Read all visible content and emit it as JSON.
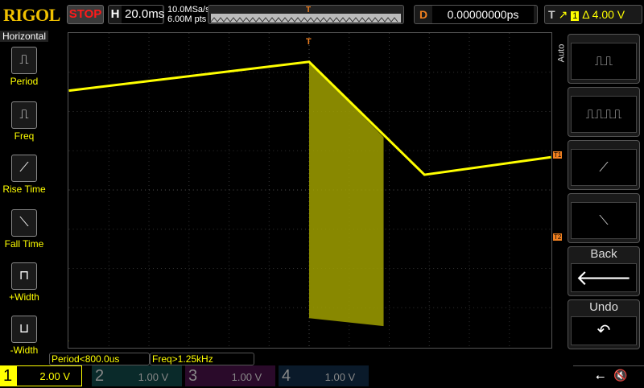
{
  "header": {
    "logo": "RIGOL",
    "run_state": "STOP",
    "horizontal_key": "H",
    "timebase": "20.0ms",
    "sample_rate": "10.0MSa/s",
    "memory_depth": "6.00M pts",
    "delay_key": "D",
    "delay": "0.00000000ps",
    "trigger_key": "T",
    "trigger_source": "1",
    "trigger_level": "Δ 4.00 V"
  },
  "left_menu": {
    "title": "Horizontal",
    "items": [
      {
        "label": "Period"
      },
      {
        "label": "Freq"
      },
      {
        "label": "Rise Time"
      },
      {
        "label": "Fall Time"
      },
      {
        "label": "+Width"
      },
      {
        "label": "-Width"
      }
    ]
  },
  "right_menu": {
    "mode": "Auto",
    "back": "Back",
    "undo": "Undo"
  },
  "markers": {
    "t1": "T1",
    "t2": "T2",
    "trigger": "T"
  },
  "measurements": [
    "Period<800.0us",
    "Freq>1.25kHz"
  ],
  "channels": [
    {
      "num": "1",
      "scale": "2.00 V",
      "color": "#ffff00",
      "active": true
    },
    {
      "num": "2",
      "scale": "1.00 V",
      "color": "#00a0a0"
    },
    {
      "num": "3",
      "scale": "1.00 V",
      "color": "#c020c0"
    },
    {
      "num": "4",
      "scale": "1.00 V",
      "color": "#2060c0"
    }
  ],
  "colors": {
    "ch1": "#ffff00",
    "trigger": "#f08020"
  }
}
